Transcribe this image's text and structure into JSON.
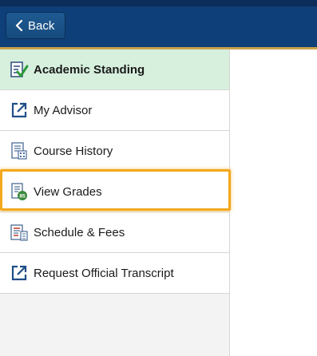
{
  "header": {
    "back_label": "Back"
  },
  "sidebar": {
    "items": [
      {
        "label": "Academic Standing",
        "icon": "checklist-icon",
        "active": true
      },
      {
        "label": "My Advisor",
        "icon": "external-link-icon"
      },
      {
        "label": "Course History",
        "icon": "calendar-list-icon"
      },
      {
        "label": "View Grades",
        "icon": "grades-icon",
        "highlighted": true
      },
      {
        "label": "Schedule & Fees",
        "icon": "schedule-fees-icon"
      },
      {
        "label": "Request Official Transcript",
        "icon": "external-link-icon"
      }
    ]
  },
  "colors": {
    "header_bg": "#0f3f78",
    "active_bg": "#d7f0de",
    "focus_ring": "#f2a81d",
    "gold_rule": "#c9a24a"
  }
}
